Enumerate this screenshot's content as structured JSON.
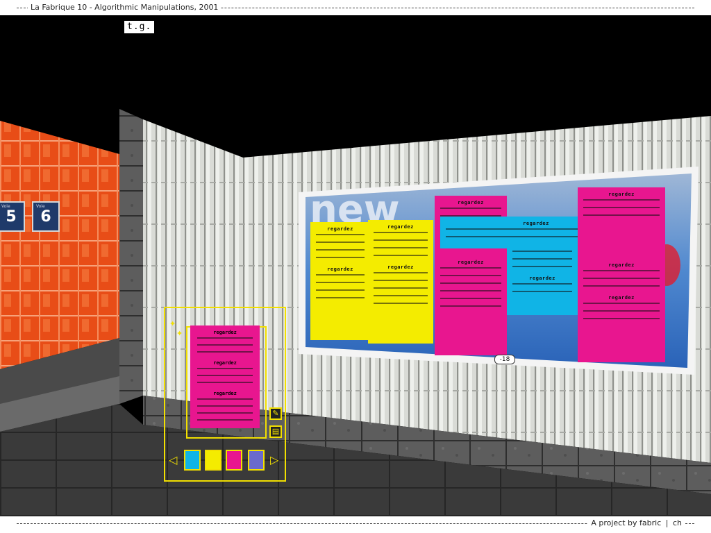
{
  "header": {
    "title": "La Fabrique 10 - Algorithmic Manipulations, 2001"
  },
  "footer": {
    "credit_prefix": "A project by",
    "credit_name": "fabric",
    "credit_sep": "|",
    "credit_country": "ch"
  },
  "overlay": {
    "tg_label": "t.g."
  },
  "scene": {
    "platform_signs": [
      {
        "number": "5",
        "small": "Voie"
      },
      {
        "number": "6",
        "small": "Voie"
      }
    ],
    "billboard": {
      "brand_text": "new",
      "age_badge": "-18",
      "poster_heading": "regardez"
    }
  },
  "nav": {
    "prev_arrow": "◁",
    "next_arrow": "▷",
    "thumbs": [
      "poster-thumb-1",
      "poster-thumb-2",
      "poster-thumb-3",
      "poster-thumb-4"
    ]
  },
  "colors": {
    "cyan": "#10b4e6",
    "magenta": "#e8168f",
    "yellow": "#f4ec00",
    "accent": "#f2e000",
    "wall_orange": "#e8531c"
  }
}
